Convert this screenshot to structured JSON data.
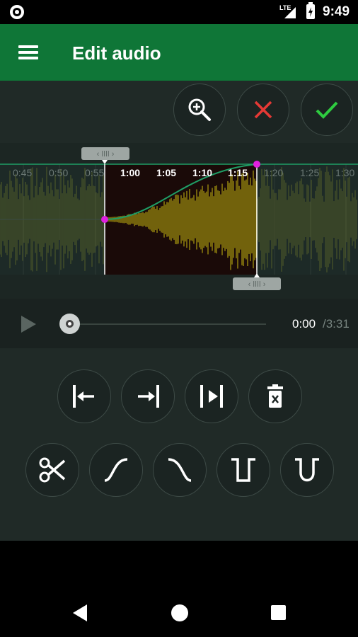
{
  "status_bar": {
    "network_label": "LTE",
    "time": "9:49"
  },
  "app_bar": {
    "title": "Edit audio",
    "menu_icon": "hamburger-menu-icon"
  },
  "actions": [
    {
      "name": "zoom-in",
      "icon": "zoom-in-icon"
    },
    {
      "name": "cancel",
      "icon": "close-icon",
      "color": "#e53935"
    },
    {
      "name": "confirm",
      "icon": "check-icon",
      "color": "#2ecc40"
    }
  ],
  "waveform": {
    "time_labels": [
      "0:45",
      "0:50",
      "0:55",
      "1:00",
      "1:05",
      "1:10",
      "1:15",
      "1:20",
      "1:25",
      "1:30"
    ],
    "selection_color": "#3a3000",
    "wave_color": "#b5a410",
    "fade_curve_color": "#1f9e66",
    "fade_point_color": "#e020e0"
  },
  "player": {
    "current_time": "0:00",
    "total_time": "/3:31"
  },
  "tools_row1": [
    {
      "name": "trim-start",
      "icon": "trim-start-icon"
    },
    {
      "name": "trim-end",
      "icon": "trim-end-icon"
    },
    {
      "name": "trim-both",
      "icon": "trim-both-icon"
    },
    {
      "name": "delete",
      "icon": "delete-icon"
    }
  ],
  "tools_row2": [
    {
      "name": "cut",
      "icon": "scissors-icon"
    },
    {
      "name": "fade-in",
      "icon": "fade-in-icon"
    },
    {
      "name": "fade-out",
      "icon": "fade-out-icon"
    },
    {
      "name": "silence",
      "icon": "silence-icon"
    },
    {
      "name": "volume-dip",
      "icon": "volume-dip-icon"
    }
  ]
}
